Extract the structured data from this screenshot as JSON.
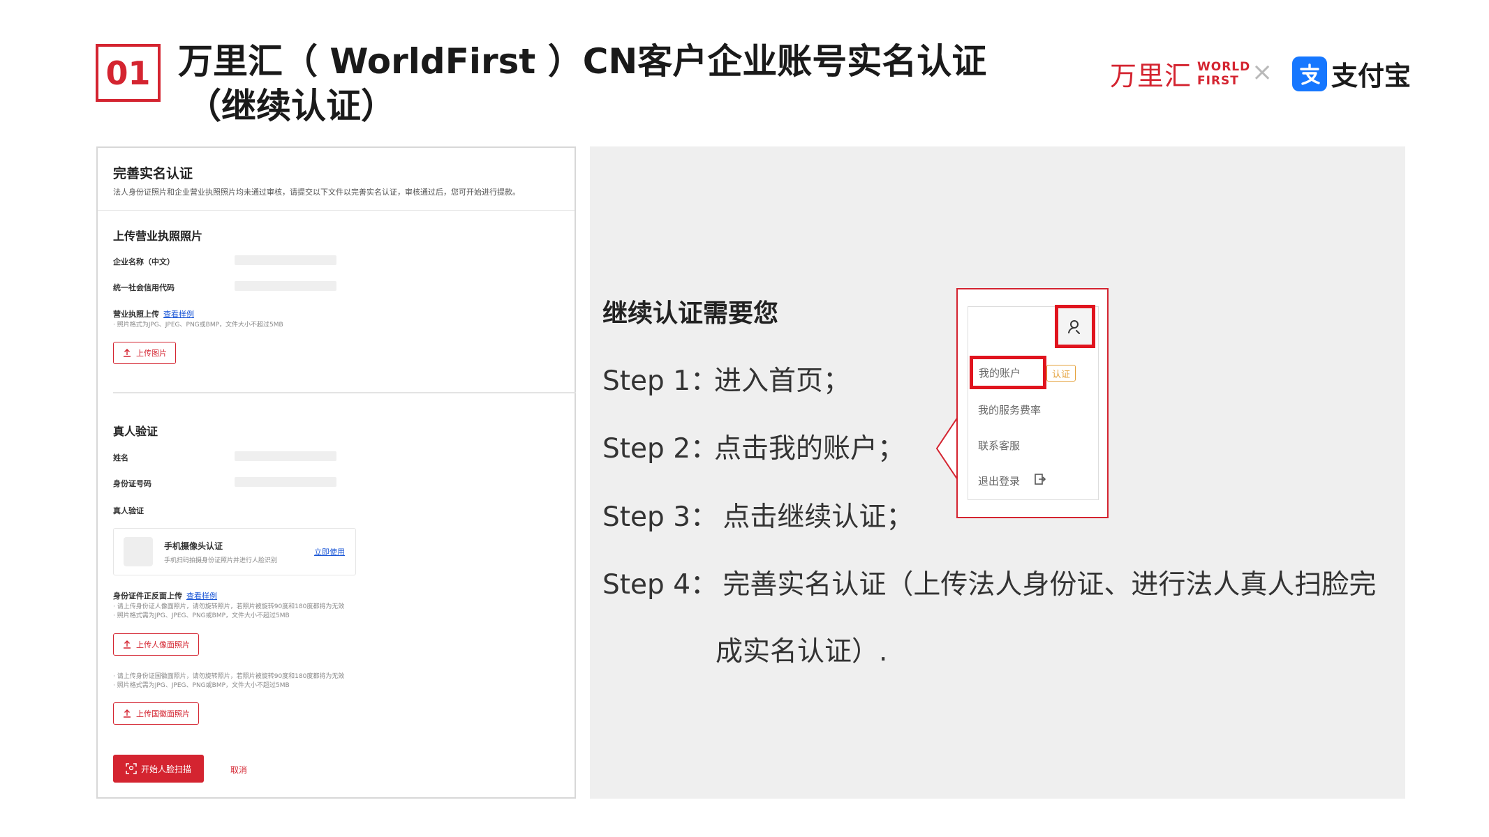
{
  "header": {
    "number": "01",
    "title_line1": "万里汇（ WorldFirst ）CN客户企业账号实名认证",
    "title_line2": "（继续认证）",
    "logo_wf_cn": "万里汇",
    "logo_wf_en_1": "WORLD",
    "logo_wf_en_2": "FIRST",
    "logo_times": "×",
    "logo_alipay": "支付宝"
  },
  "form": {
    "title": "完善实名认证",
    "desc": "法人身份证照片和企业营业执照照片均未通过审核，请提交以下文件以完善实名认证，审核通过后，您可开始进行提款。",
    "license_section": "上传营业执照照片",
    "company_name_label": "企业名称（中文）",
    "credit_code_label": "统一社会信用代码",
    "license_upload_label": "营业执照上传",
    "view_sample": "查看样例",
    "license_hint": "· 照片格式为JPG、JPEG、PNG或BMP，文件大小不超过5MB",
    "upload_image_btn": "上传图片",
    "person_section": "真人验证",
    "name_label": "姓名",
    "id_number_label": "身份证号码",
    "face_verify_label": "真人验证",
    "camera_title": "手机摄像头认证",
    "camera_sub": "手机扫码拍摄身份证照片并进行人脸识别",
    "use_now": "立即使用",
    "id_upload_label": "身份证件正反面上传",
    "id_hint_portrait_1": "· 请上传身份证人像面照片，请勿旋转照片，若照片被旋转90度和180度都将为无效",
    "id_hint_portrait_2": "· 照片格式需为JPG、JPEG、PNG或BMP，文件大小不超过5MB",
    "upload_portrait_btn": "上传人像面照片",
    "id_hint_emblem_1": "· 请上传身份证国徽面照片，请勿旋转照片，若照片被旋转90度和180度都将为无效",
    "id_hint_emblem_2": "· 照片格式需为JPG、JPEG、PNG或BMP，文件大小不超过5MB",
    "upload_emblem_btn": "上传国徽面照片",
    "start_scan_btn": "开始人脸扫描",
    "cancel": "取消"
  },
  "instructions": {
    "heading": "继续认证需要您",
    "steps": [
      {
        "label": "Step 1：",
        "text": "进入首页；"
      },
      {
        "label": "Step 2：",
        "text": "点击我的账户；"
      },
      {
        "label": "Step 3：",
        "text": " 点击继续认证；"
      },
      {
        "label": "Step 4：",
        "text": " 完善实名认证（上传法人身份证、进行法人真人扫脸完"
      }
    ],
    "step4_cont": "成实名认证）."
  },
  "dropdown": {
    "my_account": "我的账户",
    "badge": "认证",
    "service_fee": "我的服务费率",
    "contact_service": "联系客服",
    "logout": "退出登录"
  },
  "colors": {
    "brand_red": "#d42430",
    "alipay_blue": "#1677ff",
    "link_blue": "#1a56d6",
    "badge_orange": "#e4a13a"
  }
}
